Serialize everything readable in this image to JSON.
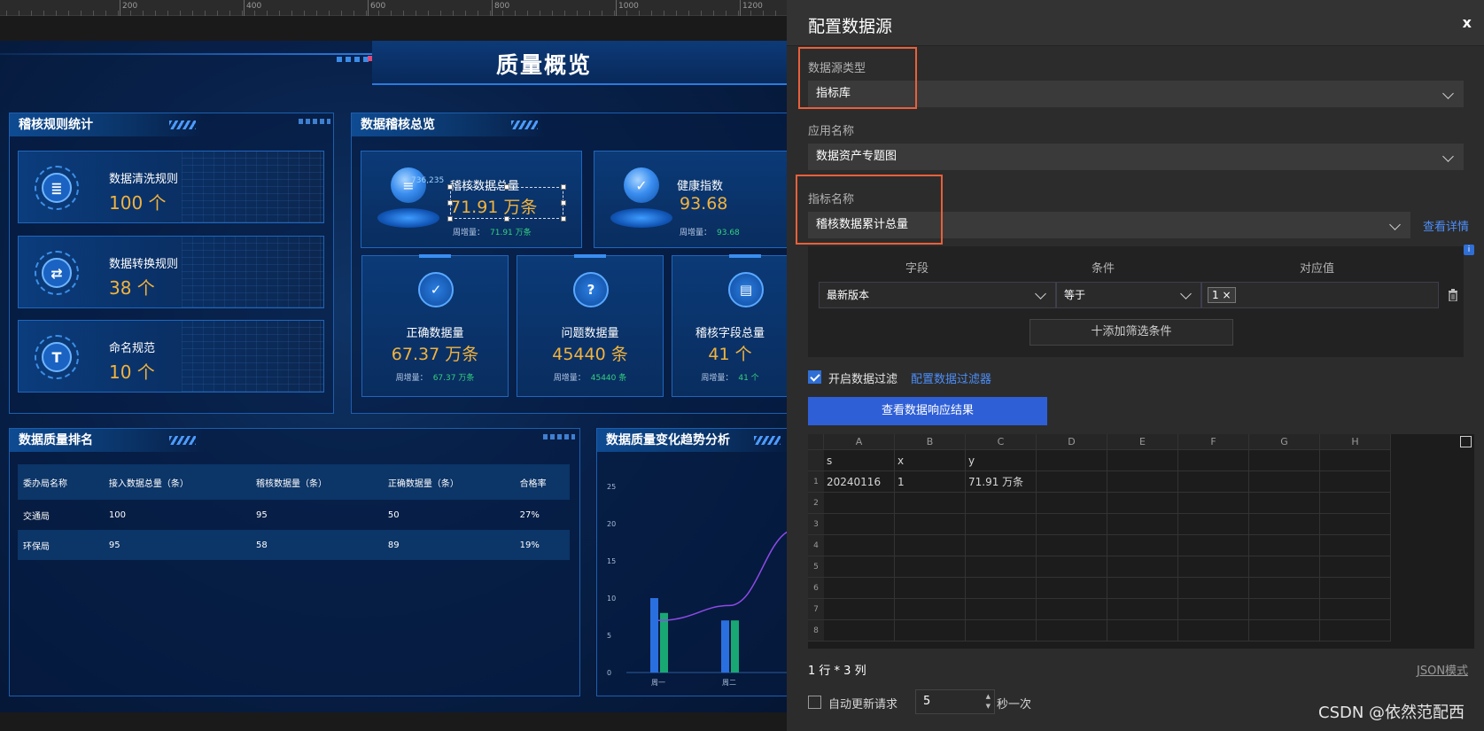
{
  "ruler": {
    "labels": [
      "200",
      "400",
      "600",
      "800",
      "1000",
      "1200"
    ]
  },
  "dashboard": {
    "title": "质量概览",
    "rule_panel": {
      "title": "稽核规则统计",
      "items": [
        {
          "name": "数据清洗规则",
          "value": "100 个",
          "icon": "clipboard-icon",
          "glyph": "≣"
        },
        {
          "name": "数据转换规则",
          "value": "38 个",
          "icon": "exchange-icon",
          "glyph": "⇄"
        },
        {
          "name": "命名规范",
          "value": "10 个",
          "icon": "text-t-icon",
          "glyph": "T"
        }
      ]
    },
    "overview_panel": {
      "title": "数据稽核总览",
      "top_cards": [
        {
          "name": "稽核数据总量",
          "value": "71.91 万条",
          "week_label": "周增量：",
          "week_value": "71.91 万条",
          "float_num": "736,235",
          "icon": "database-icon"
        },
        {
          "name": "健康指数",
          "value": "93.68",
          "week_label": "周增量：",
          "week_value": "93.68",
          "icon": "check-circle-icon"
        }
      ],
      "mini_cards": [
        {
          "name": "正确数据量",
          "value": "67.37 万条",
          "week_label": "周增量：",
          "week_value": "67.37 万条",
          "icon": "document-check-icon",
          "glyph": "✓"
        },
        {
          "name": "问题数据量",
          "value": "45440 条",
          "week_label": "周增量：",
          "week_value": "45440 条",
          "icon": "question-icon",
          "glyph": "?"
        },
        {
          "name": "稽核字段总量",
          "value": "41 个",
          "week_label": "周增量：",
          "week_value": "41 个",
          "icon": "book-icon",
          "glyph": "▤"
        }
      ]
    },
    "rank_panel": {
      "title": "数据质量排名",
      "columns": [
        "委办局名称",
        "接入数据总量（条）",
        "稽核数据量（条）",
        "正确数据量（条）",
        "合格率"
      ],
      "rows": [
        [
          "交通局",
          "100",
          "95",
          "50",
          "27%"
        ],
        [
          "环保局",
          "95",
          "58",
          "89",
          "19%"
        ]
      ]
    },
    "trend_panel": {
      "title": "数据质量变化趋势分析"
    }
  },
  "chart_data": {
    "type": "bar",
    "title": "数据质量变化趋势分析",
    "categories": [
      "周一",
      "周二"
    ],
    "series": [
      {
        "values": [
          10,
          7
        ],
        "color": "#2a6fe0"
      },
      {
        "values": [
          8,
          7
        ],
        "color": "#19a874"
      },
      {
        "type": "line",
        "values": [
          7,
          9
        ],
        "color": "#8f4ae8"
      }
    ],
    "yticks": [
      "25",
      "20",
      "15",
      "10",
      "5",
      "0"
    ],
    "ylim": [
      0,
      25
    ]
  },
  "drawer": {
    "title": "配置数据源",
    "close_label": "x",
    "source_type": {
      "label": "数据源类型",
      "value": "指标库"
    },
    "app_name": {
      "label": "应用名称",
      "value": "数据资产专题图"
    },
    "indicator": {
      "label": "指标名称",
      "value": "稽核数据累计总量",
      "detail_link": "查看详情"
    },
    "filter": {
      "headers": [
        "字段",
        "条件",
        "对应值"
      ],
      "field_value": "最新版本",
      "condition_value": "等于",
      "tag_value": "1",
      "tag_close": "×",
      "add_label": "十添加筛选条件",
      "info_glyph": "i"
    },
    "enable_filter": {
      "label": "开启数据过滤",
      "link": "配置数据过滤器",
      "checked": true
    },
    "view_result_label": "查看数据响应结果",
    "sheet": {
      "col_letters": [
        "A",
        "B",
        "C",
        "D",
        "E",
        "F",
        "G",
        "H"
      ],
      "header_row": [
        "s",
        "x",
        "y"
      ],
      "data_rows": [
        [
          "20240116",
          "1",
          "71.91 万条"
        ]
      ],
      "row_numbers": [
        "1",
        "2",
        "3",
        "4",
        "5",
        "6",
        "7",
        "8"
      ]
    },
    "row_col_count": "1 行 * 3 列",
    "json_mode_link": "JSON模式",
    "auto_update": {
      "label": "自动更新请求",
      "value": "5",
      "suffix": "秒一次",
      "checked": false
    },
    "watermark": "CSDN @依然范配西"
  }
}
